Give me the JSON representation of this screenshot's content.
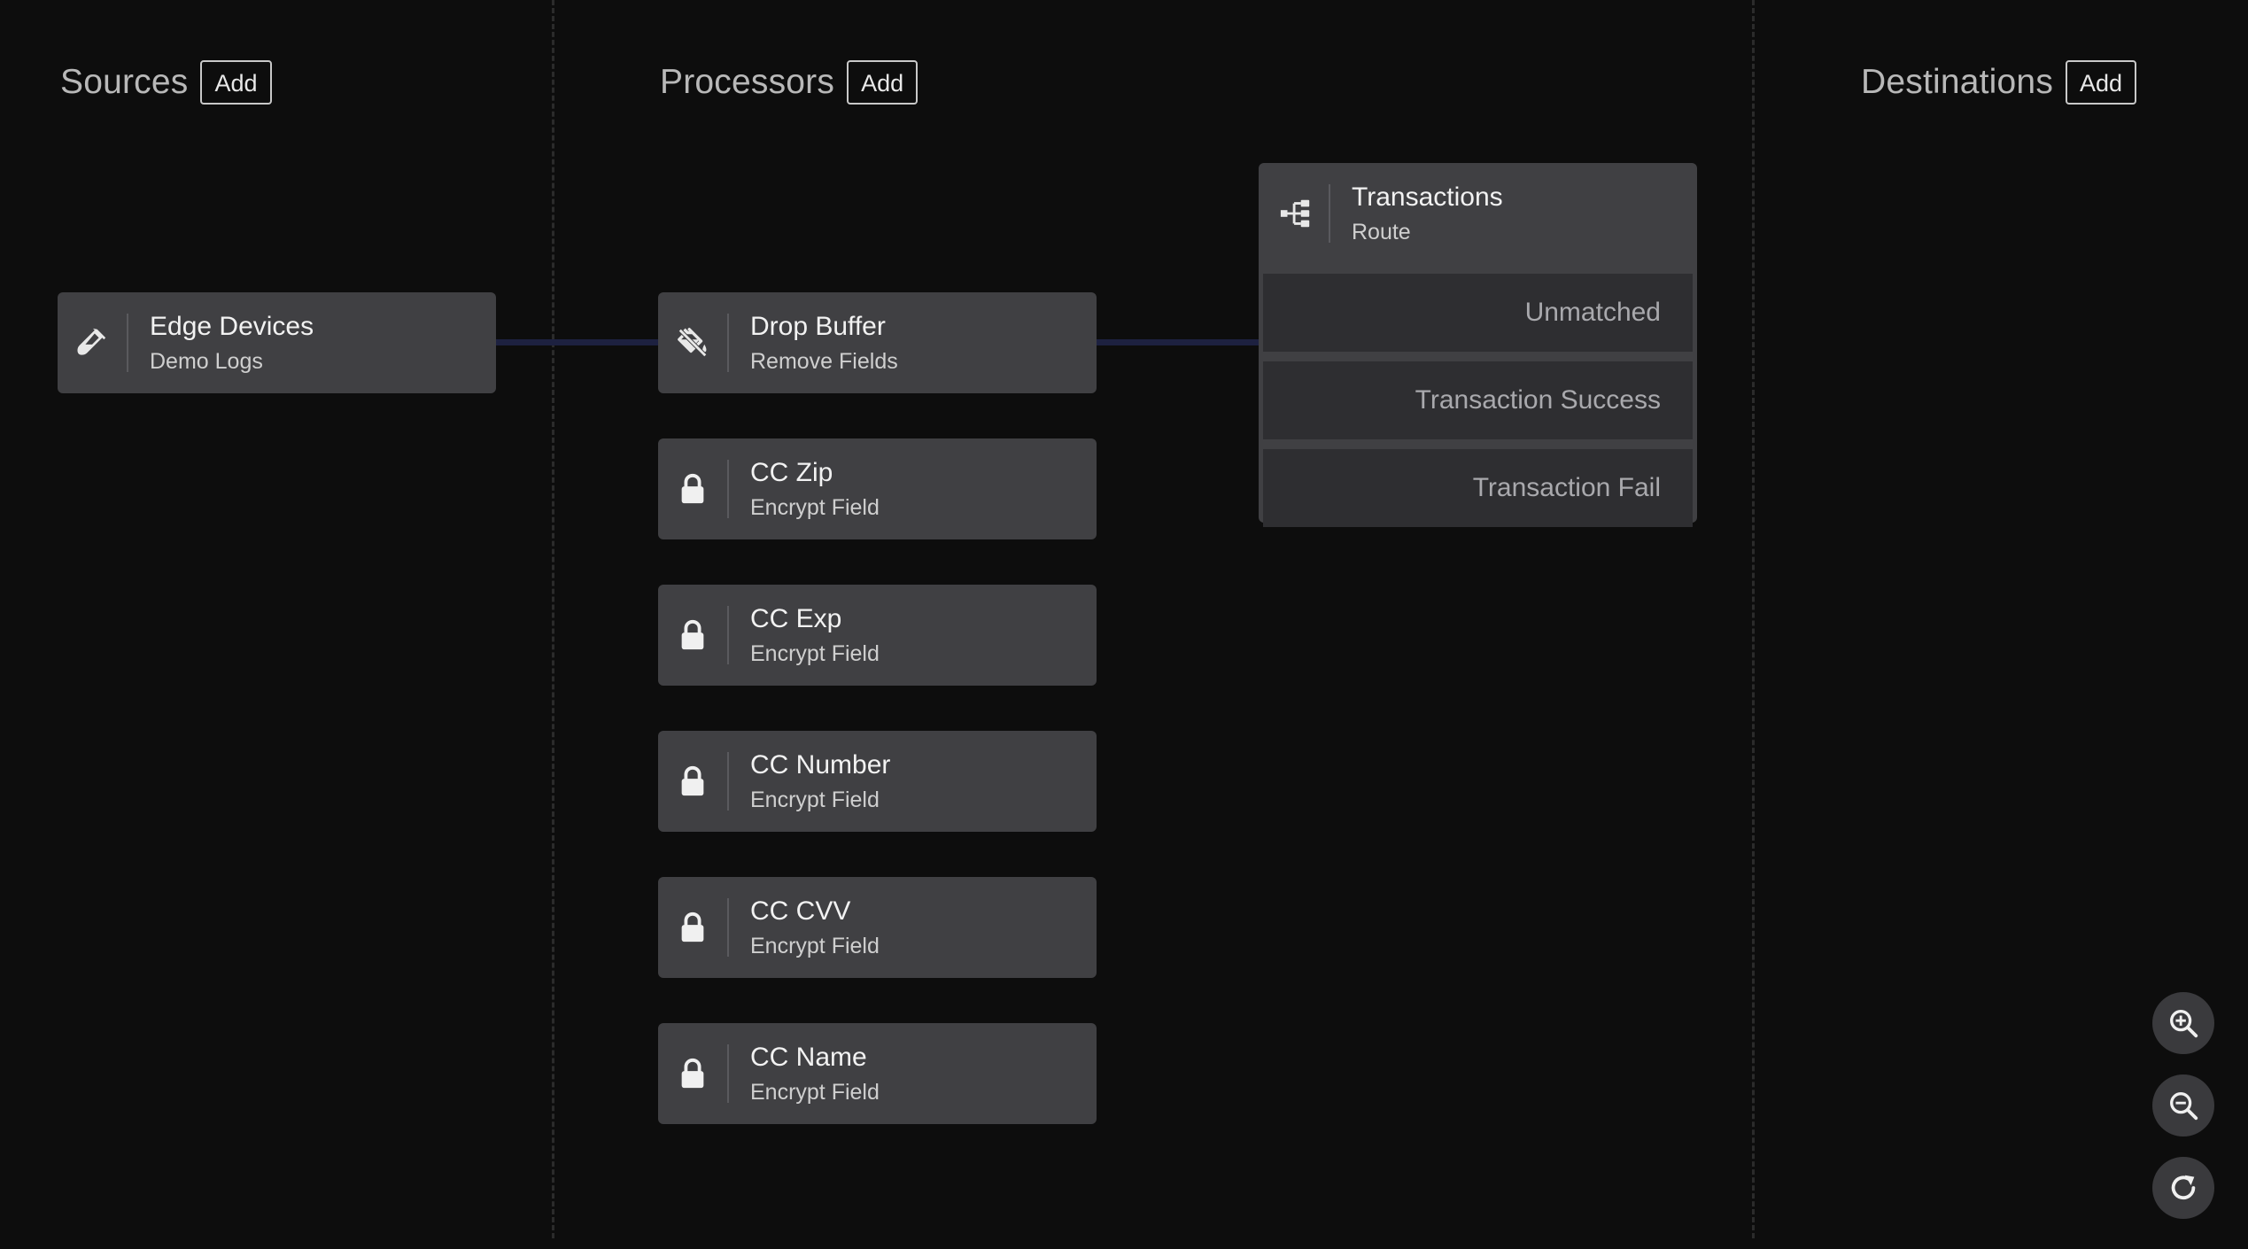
{
  "columns": {
    "sources": {
      "title": "Sources",
      "add_label": "Add"
    },
    "processors": {
      "title": "Processors",
      "add_label": "Add"
    },
    "destinations": {
      "title": "Destinations",
      "add_label": "Add"
    }
  },
  "sources": [
    {
      "name": "Edge Devices",
      "type": "Demo Logs",
      "icon": "test-tube-icon"
    }
  ],
  "processors": [
    {
      "name": "Drop Buffer",
      "type": "Remove Fields",
      "icon": "paint-bucket-icon"
    },
    {
      "name": "CC Zip",
      "type": "Encrypt Field",
      "icon": "lock-icon"
    },
    {
      "name": "CC Exp",
      "type": "Encrypt Field",
      "icon": "lock-icon"
    },
    {
      "name": "CC Number",
      "type": "Encrypt Field",
      "icon": "lock-icon"
    },
    {
      "name": "CC CVV",
      "type": "Encrypt Field",
      "icon": "lock-icon"
    },
    {
      "name": "CC Name",
      "type": "Encrypt Field",
      "icon": "lock-icon"
    }
  ],
  "route": {
    "name": "Transactions",
    "type": "Route",
    "icon": "route-branch-icon",
    "outputs": [
      "Unmatched",
      "Transaction Success",
      "Transaction Fail"
    ]
  },
  "zoom_controls": [
    {
      "icon": "zoom-in-icon"
    },
    {
      "icon": "zoom-out-icon"
    },
    {
      "icon": "reset-view-icon"
    }
  ],
  "colors": {
    "background": "#0d0d0d",
    "node": "#404043",
    "route_row": "#2e2e31",
    "connector": "#1d2140"
  }
}
